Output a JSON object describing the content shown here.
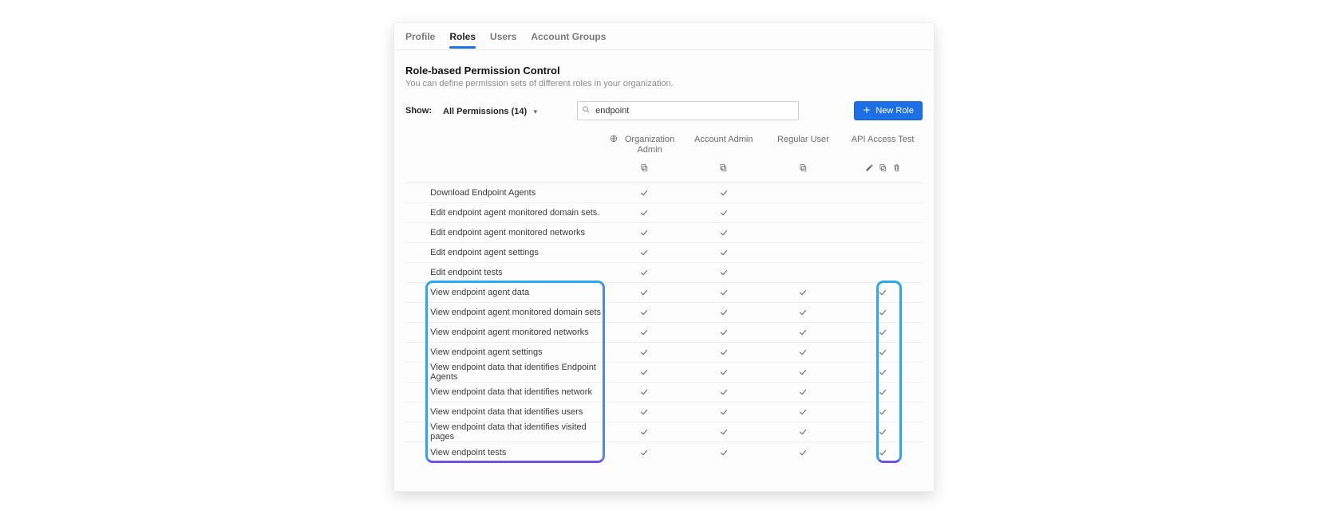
{
  "tabs": {
    "profile": "Profile",
    "roles": "Roles",
    "users": "Users",
    "groups": "Account Groups",
    "active": "roles"
  },
  "header": {
    "title": "Role-based Permission Control",
    "subtitle": "You can define permission sets of different roles in your organization."
  },
  "controls": {
    "show_label": "Show:",
    "show_value": "All Permissions (14)",
    "search_value": "endpoint",
    "new_button": "New Role"
  },
  "roles": [
    {
      "name": "Organization Admin",
      "actions": [
        "copy"
      ]
    },
    {
      "name": "Account Admin",
      "actions": [
        "copy"
      ]
    },
    {
      "name": "Regular User",
      "actions": [
        "copy"
      ]
    },
    {
      "name": "API Access Test",
      "actions": [
        "edit",
        "copy",
        "delete"
      ]
    }
  ],
  "permissions": [
    {
      "name": "Download Endpoint Agents",
      "checks": [
        true,
        true,
        false,
        false
      ]
    },
    {
      "name": "Edit endpoint agent monitored domain sets.",
      "checks": [
        true,
        true,
        false,
        false
      ]
    },
    {
      "name": "Edit endpoint agent monitored networks",
      "checks": [
        true,
        true,
        false,
        false
      ]
    },
    {
      "name": "Edit endpoint agent settings",
      "checks": [
        true,
        true,
        false,
        false
      ]
    },
    {
      "name": "Edit endpoint tests",
      "checks": [
        true,
        true,
        false,
        false
      ]
    },
    {
      "name": "View endpoint agent data",
      "checks": [
        true,
        true,
        true,
        true
      ]
    },
    {
      "name": "View endpoint agent monitored domain sets",
      "checks": [
        true,
        true,
        true,
        true
      ]
    },
    {
      "name": "View endpoint agent monitored networks",
      "checks": [
        true,
        true,
        true,
        true
      ]
    },
    {
      "name": "View endpoint agent settings",
      "checks": [
        true,
        true,
        true,
        true
      ]
    },
    {
      "name": "View endpoint data that identifies Endpoint Agents",
      "checks": [
        true,
        true,
        true,
        true
      ]
    },
    {
      "name": "View endpoint data that identifies network",
      "checks": [
        true,
        true,
        true,
        true
      ]
    },
    {
      "name": "View endpoint data that identifies users",
      "checks": [
        true,
        true,
        true,
        true
      ]
    },
    {
      "name": "View endpoint data that identifies visited pages",
      "checks": [
        true,
        true,
        true,
        true
      ]
    },
    {
      "name": "View endpoint tests",
      "checks": [
        true,
        true,
        true,
        true
      ]
    }
  ],
  "highlight": {
    "from_row": 5,
    "to_row": 13
  }
}
